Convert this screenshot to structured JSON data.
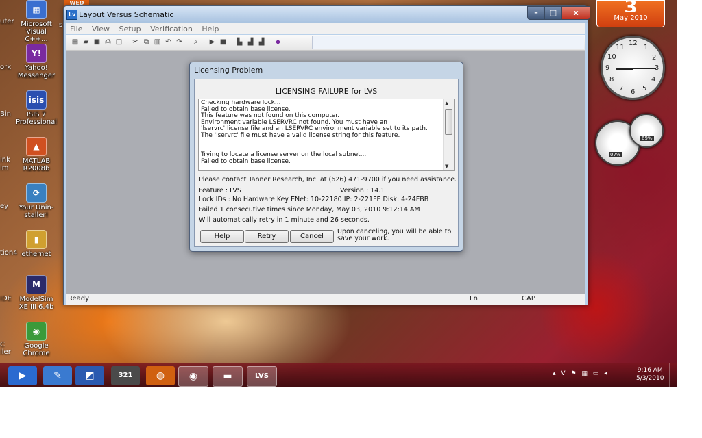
{
  "desktop": {
    "weekday_tag": "WED",
    "icons": [
      {
        "label": "Microsoft Visual C++...",
        "glyph": "▦",
        "color": "#3a6fd0"
      },
      {
        "label": "Yahoo! Messenger",
        "glyph": "Y!",
        "color": "#7a2aa0"
      },
      {
        "label": "ISIS 7 Professional",
        "glyph": "isis",
        "color": "#2a4fb0"
      },
      {
        "label": "MATLAB R2008b",
        "glyph": "▲",
        "color": "#d05020"
      },
      {
        "label": "Your Unin-staller!",
        "glyph": "⟳",
        "color": "#3a80c0"
      },
      {
        "label": "ethernet",
        "glyph": "▮",
        "color": "#d0a030"
      },
      {
        "label": "ModelSim XE III 6.4b",
        "glyph": "M",
        "color": "#2a2a6a"
      },
      {
        "label": "Google Chrome",
        "glyph": "◉",
        "color": "#3a9a3a"
      }
    ],
    "edge_labels": [
      "uter",
      "ork",
      "Bin",
      "ink",
      "im",
      "ey",
      "tion4",
      "IDE",
      "s",
      "C",
      "ller"
    ]
  },
  "window": {
    "title": "Layout Versus Schematic",
    "icon_text": "Lv",
    "controls": {
      "minimize": "–",
      "maximize": "□",
      "close": "x"
    },
    "menu": [
      "File",
      "View",
      "Setup",
      "Verification",
      "Help"
    ],
    "toolbar_icons": [
      {
        "name": "new-file-icon",
        "glyph": "▤"
      },
      {
        "name": "open-folder-icon",
        "glyph": "▰"
      },
      {
        "name": "save-icon",
        "glyph": "▣"
      },
      {
        "name": "print-icon",
        "glyph": "⎙"
      },
      {
        "name": "print-preview-icon",
        "glyph": "◫"
      },
      {
        "name": "cut-icon",
        "glyph": "✂"
      },
      {
        "name": "copy-icon",
        "glyph": "⧉"
      },
      {
        "name": "paste-icon",
        "glyph": "▥"
      },
      {
        "name": "undo-icon",
        "glyph": "↶"
      },
      {
        "name": "redo-icon",
        "glyph": "↷"
      },
      {
        "name": "find-icon",
        "glyph": "⌕"
      },
      {
        "name": "run-icon",
        "glyph": "▶"
      },
      {
        "name": "stop-icon",
        "glyph": "■"
      },
      {
        "name": "chart-icon",
        "glyph": "▙"
      },
      {
        "name": "graph-icon",
        "glyph": "▟"
      },
      {
        "name": "graph-alt-icon",
        "glyph": "▟"
      },
      {
        "name": "eraser-icon",
        "glyph": "◆"
      }
    ],
    "status": {
      "left": "Ready",
      "ln": "Ln",
      "cap": "CAP"
    }
  },
  "dialog": {
    "title": "Licensing Problem",
    "heading": "LICENSING FAILURE for LVS",
    "log_lines": [
      "Checking hardware lock...",
      "Failed to obtain base license.",
      "This feature was not found on this computer.",
      "Environment variable LSERVRC not found. You must have an",
      "'lservrc' license file and an LSERVRC environment variable set to its path.",
      "The 'lservrc' file must have a valid license string for this feature.",
      "",
      "Trying to locate a license server on the local subnet...",
      "Failed to obtain base license."
    ],
    "contact": "Please contact Tanner Research, Inc. at (626) 471-9700 if you need assistance.",
    "feature": "Feature : LVS",
    "version": "Version :  14.1",
    "lock_ids": "Lock IDs : No Hardware Key   ENet: 10-22180   IP: 2-221FE   Disk: 4-24FBB",
    "failed": "Failed 1 consecutive times since Monday, May 03, 2010 9:12:14 AM",
    "retry_note": "Will automatically retry in 1 minute and 26 seconds.",
    "buttons": {
      "help": "Help",
      "retry": "Retry",
      "cancel": "Cancel"
    },
    "cancel_note": "Upon canceling, you will be able to save your work."
  },
  "gadgets": {
    "calendar": {
      "day": "3",
      "month_year": "May 2010"
    },
    "clock_numbers": [
      "12",
      "1",
      "2",
      "3",
      "4",
      "5",
      "6",
      "7",
      "8",
      "9",
      "10",
      "11"
    ],
    "cpu_meter": "07%",
    "mem_meter": "69%"
  },
  "taskbar": {
    "items": [
      {
        "name": "media-player-icon",
        "glyph": "▶",
        "color": "#2a6ad0"
      },
      {
        "name": "wordpad-icon",
        "glyph": "✎",
        "color": "#3a7ad0"
      },
      {
        "name": "paint-icon",
        "glyph": "◩",
        "color": "#2a5ab0"
      },
      {
        "name": "calendar-app-icon",
        "glyph": "321",
        "color": "#4a4a4a"
      },
      {
        "name": "firefox-icon",
        "glyph": "◍",
        "color": "#d06010"
      },
      {
        "name": "chrome-icon",
        "glyph": "◉",
        "color": "#3a9a3a"
      },
      {
        "name": "explorer-icon",
        "glyph": "▬",
        "color": "#d0a030"
      },
      {
        "name": "lvs-app-icon",
        "glyph": "LVS",
        "color": "#3a6fd0"
      }
    ],
    "tray_icons": [
      "▴",
      "V",
      "⚑",
      "▦",
      "▭",
      "◂"
    ],
    "time": "9:16 AM",
    "date": "5/3/2010"
  }
}
